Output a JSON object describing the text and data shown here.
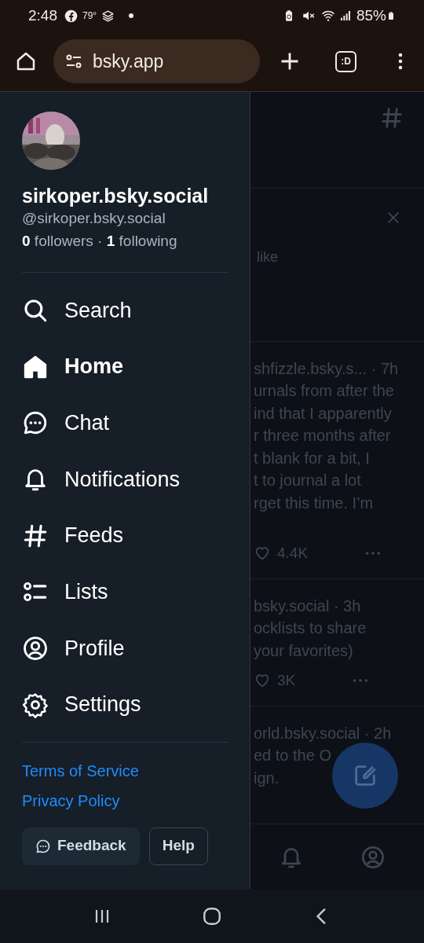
{
  "status_bar": {
    "time": "2:48",
    "temperature": "79°",
    "battery": "85%"
  },
  "browser": {
    "url": "bsky.app",
    "tab_count": ":D"
  },
  "profile": {
    "display_name": "sirkoper.bsky.social",
    "handle": "@sirkoper.bsky.social",
    "followers_count": "0",
    "followers_label": "followers",
    "separator": "·",
    "following_count": "1",
    "following_label": "following"
  },
  "menu": [
    {
      "label": "Search",
      "selected": false
    },
    {
      "label": "Home",
      "selected": true
    },
    {
      "label": "Chat",
      "selected": false
    },
    {
      "label": "Notifications",
      "selected": false
    },
    {
      "label": "Feeds",
      "selected": false
    },
    {
      "label": "Lists",
      "selected": false
    },
    {
      "label": "Profile",
      "selected": false
    },
    {
      "label": "Settings",
      "selected": false
    }
  ],
  "links": [
    "Terms of Service",
    "Privacy Policy"
  ],
  "buttons": [
    {
      "label": "Feedback",
      "kind": "filled"
    },
    {
      "label": "Help",
      "kind": "outline"
    }
  ],
  "background_feed": {
    "banner_text": "like",
    "posts": [
      {
        "meta": "shfizzle.bsky.s... · 7h",
        "lines": [
          "urnals from after the",
          "ind that I apparently",
          "r three months after",
          "t blank for a bit, I",
          "t to journal a lot",
          "rget this time. I’m"
        ],
        "likes": "4.4K"
      },
      {
        "meta": "bsky.social · 3h",
        "lines": [
          "ocklists to share",
          "your favorites)"
        ],
        "likes": "3K"
      },
      {
        "meta": "orld.bsky.social · 2h",
        "lines": [
          "ed to the O",
          "ign."
        ]
      }
    ]
  }
}
